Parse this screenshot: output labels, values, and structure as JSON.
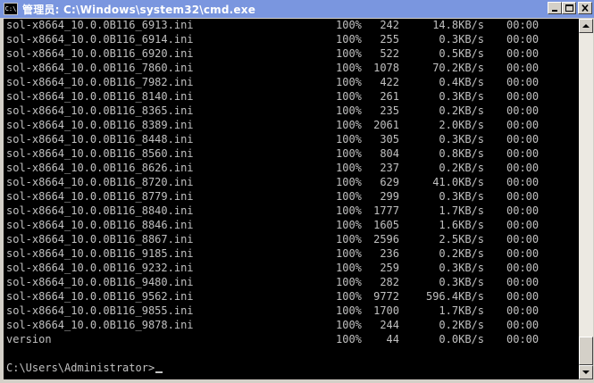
{
  "window": {
    "title": "管理员: C:\\Windows\\system32\\cmd.exe",
    "icon": "cmd-icon",
    "icon_label": "C:\\"
  },
  "colors": {
    "titlebar": "#7a96df",
    "console_bg": "#000000",
    "console_fg": "#c0c0c0"
  },
  "rows": [
    {
      "name": "sol-x8664_10.0.0B116_6913.ini",
      "pct": "100%",
      "size": "242",
      "rate": "14.8KB/s",
      "time": "00:00"
    },
    {
      "name": "sol-x8664_10.0.0B116_6914.ini",
      "pct": "100%",
      "size": "255",
      "rate": "0.3KB/s",
      "time": "00:00"
    },
    {
      "name": "sol-x8664_10.0.0B116_6920.ini",
      "pct": "100%",
      "size": "522",
      "rate": "0.5KB/s",
      "time": "00:00"
    },
    {
      "name": "sol-x8664_10.0.0B116_7860.ini",
      "pct": "100%",
      "size": "1078",
      "rate": "70.2KB/s",
      "time": "00:00"
    },
    {
      "name": "sol-x8664_10.0.0B116_7982.ini",
      "pct": "100%",
      "size": "422",
      "rate": "0.4KB/s",
      "time": "00:00"
    },
    {
      "name": "sol-x8664_10.0.0B116_8140.ini",
      "pct": "100%",
      "size": "261",
      "rate": "0.3KB/s",
      "time": "00:00"
    },
    {
      "name": "sol-x8664_10.0.0B116_8365.ini",
      "pct": "100%",
      "size": "235",
      "rate": "0.2KB/s",
      "time": "00:00"
    },
    {
      "name": "sol-x8664_10.0.0B116_8389.ini",
      "pct": "100%",
      "size": "2061",
      "rate": "2.0KB/s",
      "time": "00:00"
    },
    {
      "name": "sol-x8664_10.0.0B116_8448.ini",
      "pct": "100%",
      "size": "305",
      "rate": "0.3KB/s",
      "time": "00:00"
    },
    {
      "name": "sol-x8664_10.0.0B116_8560.ini",
      "pct": "100%",
      "size": "804",
      "rate": "0.8KB/s",
      "time": "00:00"
    },
    {
      "name": "sol-x8664_10.0.0B116_8626.ini",
      "pct": "100%",
      "size": "237",
      "rate": "0.2KB/s",
      "time": "00:00"
    },
    {
      "name": "sol-x8664_10.0.0B116_8720.ini",
      "pct": "100%",
      "size": "629",
      "rate": "41.0KB/s",
      "time": "00:00"
    },
    {
      "name": "sol-x8664_10.0.0B116_8779.ini",
      "pct": "100%",
      "size": "299",
      "rate": "0.3KB/s",
      "time": "00:00"
    },
    {
      "name": "sol-x8664_10.0.0B116_8840.ini",
      "pct": "100%",
      "size": "1777",
      "rate": "1.7KB/s",
      "time": "00:00"
    },
    {
      "name": "sol-x8664_10.0.0B116_8846.ini",
      "pct": "100%",
      "size": "1605",
      "rate": "1.6KB/s",
      "time": "00:00"
    },
    {
      "name": "sol-x8664_10.0.0B116_8867.ini",
      "pct": "100%",
      "size": "2596",
      "rate": "2.5KB/s",
      "time": "00:00"
    },
    {
      "name": "sol-x8664_10.0.0B116_9185.ini",
      "pct": "100%",
      "size": "236",
      "rate": "0.2KB/s",
      "time": "00:00"
    },
    {
      "name": "sol-x8664_10.0.0B116_9232.ini",
      "pct": "100%",
      "size": "259",
      "rate": "0.3KB/s",
      "time": "00:00"
    },
    {
      "name": "sol-x8664_10.0.0B116_9480.ini",
      "pct": "100%",
      "size": "282",
      "rate": "0.3KB/s",
      "time": "00:00"
    },
    {
      "name": "sol-x8664_10.0.0B116_9562.ini",
      "pct": "100%",
      "size": "9772",
      "rate": "596.4KB/s",
      "time": "00:00"
    },
    {
      "name": "sol-x8664_10.0.0B116_9855.ini",
      "pct": "100%",
      "size": "1700",
      "rate": "1.7KB/s",
      "time": "00:00"
    },
    {
      "name": "sol-x8664_10.0.0B116_9878.ini",
      "pct": "100%",
      "size": "244",
      "rate": "0.2KB/s",
      "time": "00:00"
    },
    {
      "name": "version",
      "pct": "100%",
      "size": "44",
      "rate": "0.0KB/s",
      "time": "00:00"
    }
  ],
  "prompt": "C:\\Users\\Administrator>"
}
